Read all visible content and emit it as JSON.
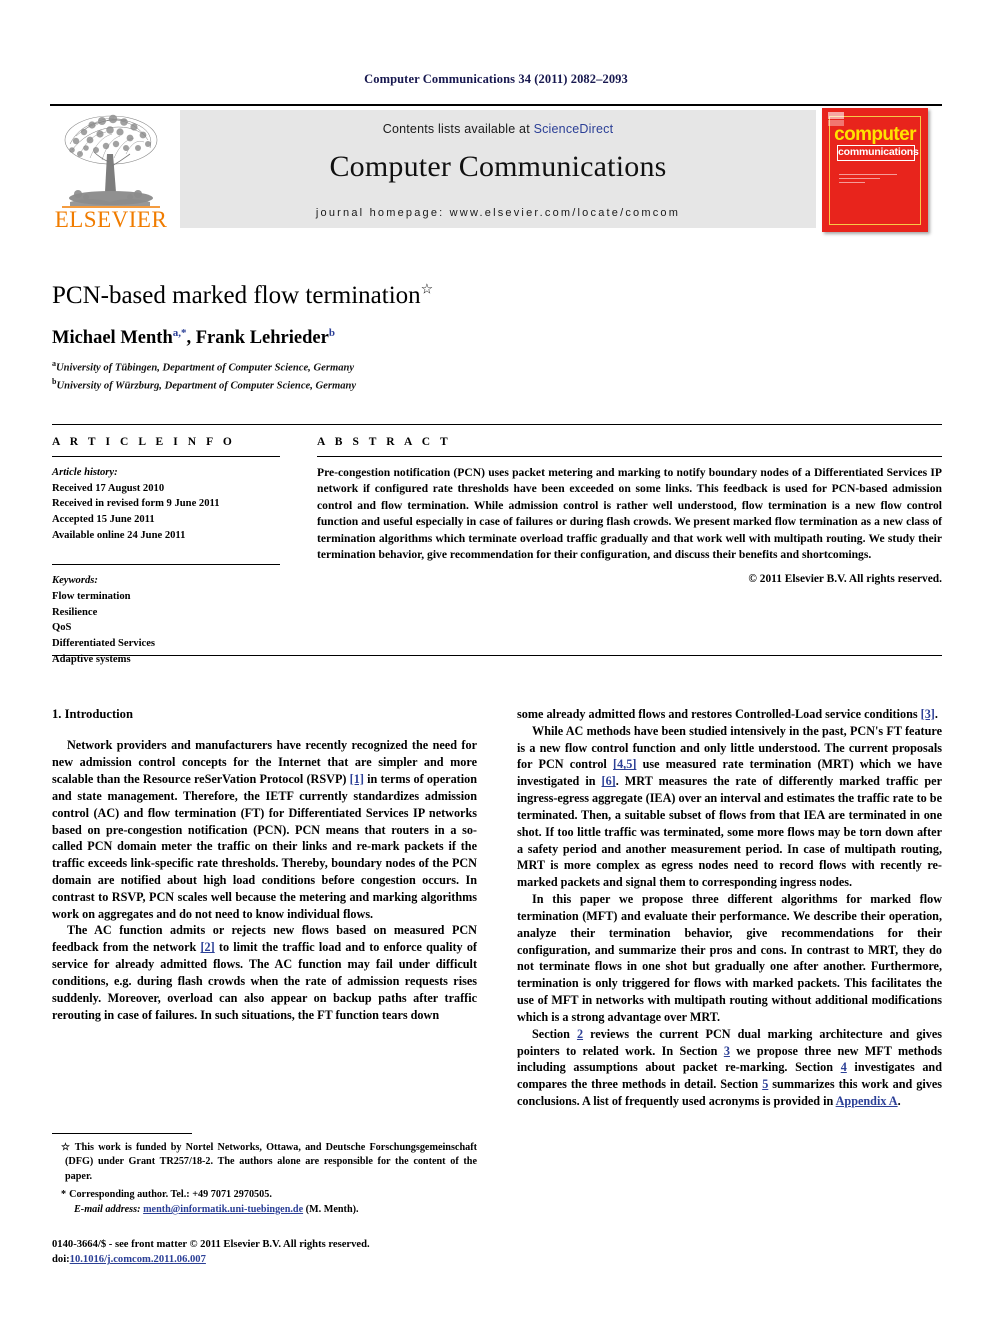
{
  "running_head": "Computer Communications 34 (2011) 2082–2093",
  "masthead": {
    "contents_prefix": "Contents lists available at",
    "sciencedirect": "ScienceDirect",
    "journal_title": "Computer Communications",
    "homepage": "journal homepage: www.elsevier.com/locate/comcom",
    "publisher_logo_text": "ELSEVIER",
    "cover": {
      "word_top": "computer",
      "word_bottom": "communications"
    }
  },
  "article": {
    "title": "PCN-based marked flow termination",
    "title_footnote_mark": "☆",
    "authors_html": "Michael Menth, Frank Lehrieder",
    "author1": "Michael Menth",
    "author1_sup": "a,*",
    "author2": "Frank Lehrieder",
    "author2_sup": "b",
    "affiliation_a_sup": "a",
    "affiliation_a": "University of Tübingen, Department of Computer Science, Germany",
    "affiliation_b_sup": "b",
    "affiliation_b": "University of Würzburg, Department of Computer Science, Germany"
  },
  "info": {
    "heading": "A R T I C L E  I N F O",
    "history_label": "Article history:",
    "history": [
      "Received 17 August 2010",
      "Received in revised form 9 June 2011",
      "Accepted 15 June 2011",
      "Available online 24 June 2011"
    ],
    "keywords_label": "Keywords:",
    "keywords": [
      "Flow termination",
      "Resilience",
      "QoS",
      "Differentiated Services",
      "Adaptive systems"
    ]
  },
  "abstract": {
    "heading": "A B S T R A C T",
    "text": "Pre-congestion notification (PCN) uses packet metering and marking to notify boundary nodes of a Differentiated Services IP network if configured rate thresholds have been exceeded on some links. This feedback is used for PCN-based admission control and flow termination. While admission control is rather well understood, flow termination is a new flow control function and useful especially in case of failures or during flash crowds. We present marked flow termination as a new class of termination algorithms which terminate overload traffic gradually and that work well with multipath routing. We study their termination behavior, give recommendation for their configuration, and discuss their benefits and shortcomings.",
    "copyright": "© 2011 Elsevier B.V. All rights reserved."
  },
  "body": {
    "section1_heading": "1. Introduction",
    "left_paragraphs": [
      {
        "parts": [
          {
            "t": "Network providers and manufacturers have recently recognized the need for new admission control concepts for the Internet that are simpler and more scalable than the Resource reSerVation Protocol (RSVP) "
          },
          {
            "t": "[1]",
            "link": true
          },
          {
            "t": " in terms of operation and state management. Therefore, the IETF currently standardizes admission control (AC) and flow termination (FT) for Differentiated Services IP networks based on pre-congestion notification (PCN). PCN means that routers in a so-called PCN domain meter the traffic on their links and re-mark packets if the traffic exceeds link-specific rate thresholds. Thereby, boundary nodes of the PCN domain are notified about high load conditions before congestion occurs. In contrast to RSVP, PCN scales well because the metering and marking algorithms work on aggregates and do not need to know individual flows."
          }
        ]
      },
      {
        "parts": [
          {
            "t": "The AC function admits or rejects new flows based on measured PCN feedback from the network "
          },
          {
            "t": "[2]",
            "link": true
          },
          {
            "t": " to limit the traffic load and to enforce quality of service for already admitted flows. The AC function may fail under difficult conditions, e.g. during flash crowds when the rate of admission requests rises suddenly. Moreover, overload can also appear on backup paths after traffic rerouting in case of failures. In such situations, the FT function tears down"
          }
        ]
      }
    ],
    "right_paragraphs": [
      {
        "noindent": true,
        "parts": [
          {
            "t": "some already admitted flows and restores Controlled-Load service conditions "
          },
          {
            "t": "[3]",
            "link": true
          },
          {
            "t": "."
          }
        ]
      },
      {
        "parts": [
          {
            "t": "While AC methods have been studied intensively in the past, PCN's FT feature is a new flow control function and only little understood. The current proposals for PCN control "
          },
          {
            "t": "[4,5]",
            "link": true
          },
          {
            "t": " use measured rate termination (MRT) which we have investigated in "
          },
          {
            "t": "[6]",
            "link": true
          },
          {
            "t": ". MRT measures the rate of differently marked traffic per ingress-egress aggregate (IEA) over an interval and estimates the traffic rate to be terminated. Then, a suitable subset of flows from that IEA are terminated in one shot. If too little traffic was terminated, some more flows may be torn down after a safety period and another measurement period. In case of multipath routing, MRT is more complex as egress nodes need to record flows with recently re-marked packets and signal them to corresponding ingress nodes."
          }
        ]
      },
      {
        "parts": [
          {
            "t": "In this paper we propose three different algorithms for marked flow termination (MFT) and evaluate their performance. We describe their operation, analyze their termination behavior, give recommendations for their configuration, and summarize their pros and cons. In contrast to MRT, they do not terminate flows in one shot but gradually one after another. Furthermore, termination is only triggered for flows with marked packets. This facilitates the use of MFT in networks with multipath routing without additional modifications which is a strong advantage over MRT."
          }
        ]
      },
      {
        "parts": [
          {
            "t": "Section "
          },
          {
            "t": "2",
            "link": true
          },
          {
            "t": " reviews the current PCN dual marking architecture and gives pointers to related work. In Section "
          },
          {
            "t": "3",
            "link": true
          },
          {
            "t": " we propose three new MFT methods including assumptions about packet re-marking. Section "
          },
          {
            "t": "4",
            "link": true
          },
          {
            "t": " investigates and compares the three methods in detail. Section "
          },
          {
            "t": "5",
            "link": true
          },
          {
            "t": " summarizes this work and gives conclusions. A list of frequently used acronyms is provided in "
          },
          {
            "t": "Appendix A",
            "link": true
          },
          {
            "t": "."
          }
        ]
      }
    ]
  },
  "footnotes": {
    "funding_marker": "☆",
    "funding": "This work is funded by Nortel Networks, Ottawa, and Deutsche Forschungsgemeinschaft (DFG) under Grant TR257/18-2. The authors alone are responsible for the content of the paper.",
    "corresponding_marker": "*",
    "corresponding": "Corresponding author. Tel.: +49 7071 2970505.",
    "email_label": "E-mail address:",
    "email": "menth@informatik.uni-tuebingen.de",
    "email_owner": "(M. Menth)."
  },
  "imprint": {
    "issn_line": "0140-3664/$ - see front matter © 2011 Elsevier B.V. All rights reserved.",
    "doi_prefix": "doi:",
    "doi": "10.1016/j.comcom.2011.06.007"
  },
  "colors": {
    "link": "#2b3f96",
    "running_head": "#17184f",
    "elsevier_orange": "#f07c00",
    "cover_red": "#e8241c",
    "cover_yellow": "#ffe200",
    "masthead_gray": "#e6e6e6"
  }
}
